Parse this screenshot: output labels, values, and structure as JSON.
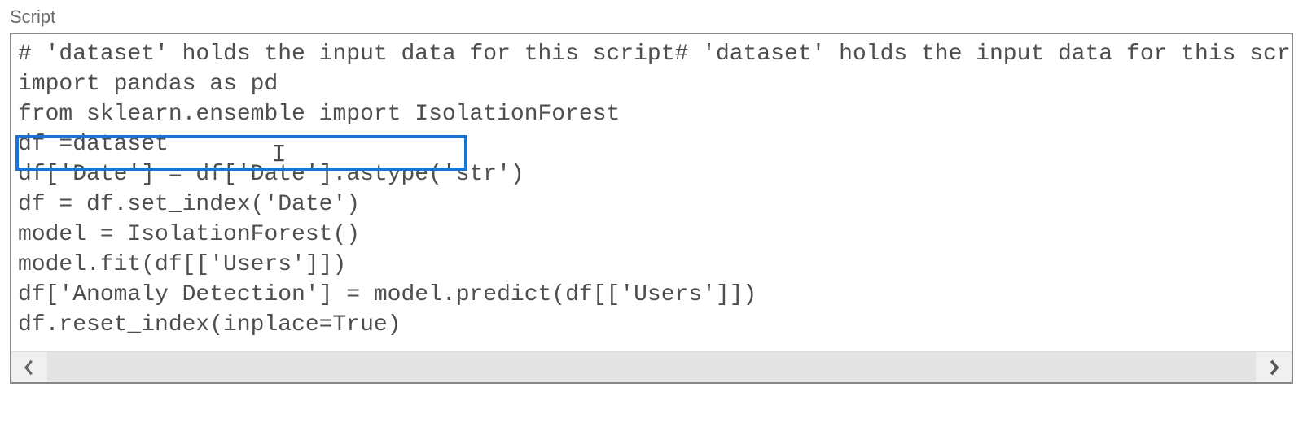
{
  "section_label": "Script",
  "highlight_box": {
    "line_index": 3
  },
  "code_lines": [
    "# 'dataset' holds the input data for this script# 'dataset' holds the input data for this script",
    "import pandas as pd",
    "from sklearn.ensemble import IsolationForest",
    "df =dataset",
    "df['Date'] = df['Date'].astype('str')",
    "df = df.set_index('Date')",
    "model = IsolationForest()",
    "model.fit(df[['Users']])",
    "df['Anomaly Detection'] = model.predict(df[['Users']])",
    "df.reset_index(inplace=True)"
  ]
}
